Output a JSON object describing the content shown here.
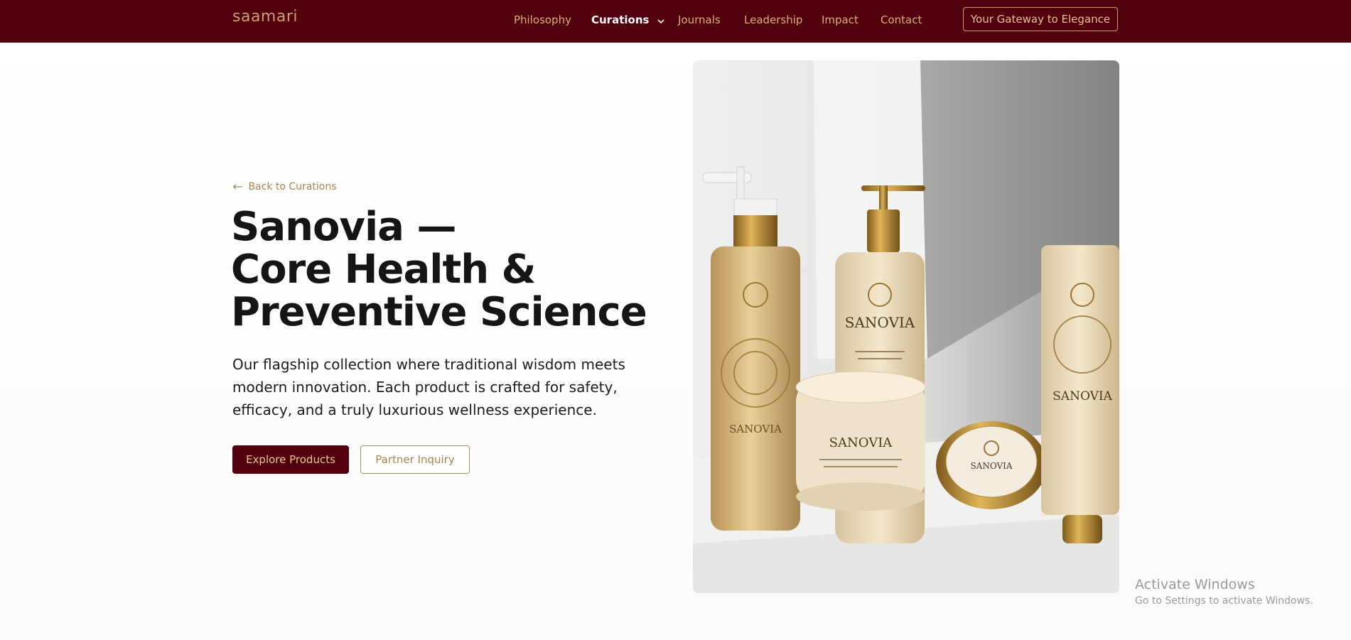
{
  "brand": {
    "logo": "saamari"
  },
  "nav": {
    "items": [
      {
        "label": "Philosophy",
        "active": false
      },
      {
        "label": "Curations",
        "active": true,
        "icon": "chevron-down-icon"
      },
      {
        "label": "Journals",
        "active": false
      },
      {
        "label": "Leadership",
        "active": false
      },
      {
        "label": "Impact",
        "active": false
      },
      {
        "label": "Contact",
        "active": false
      }
    ],
    "cta_label": "Your Gateway to Elegance"
  },
  "hero": {
    "back_link": "Back to Curations",
    "back_icon": "arrow-left-icon",
    "title_lines": [
      "Sanovia —",
      "Core Health &",
      "Preventive Science"
    ],
    "description": "Our flagship collection where traditional wisdom meets modern innovation. Each product is crafted for safety, efficacy, and a truly luxurious wellness experience.",
    "primary_button": "Explore Products",
    "secondary_button": "Partner Inquiry"
  },
  "image": {
    "description_icon": "product-photo",
    "product_labels": [
      "SANOVIA",
      "SANOVIA",
      "SANOVIA",
      "SANOVIA",
      "SANOVIA"
    ]
  },
  "watermark": {
    "title": "Activate Windows",
    "subtitle": "Go to Settings to activate Windows."
  },
  "colors": {
    "nav_bg": "#52000d",
    "gold": "#c9a067",
    "text_dark": "#151515",
    "primary_button_bg": "#52000d"
  }
}
